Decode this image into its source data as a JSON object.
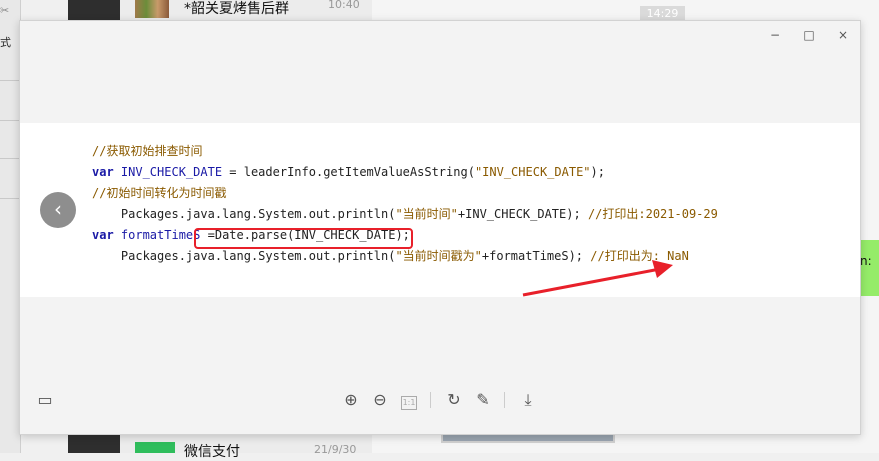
{
  "background": {
    "left_edge_labels": [
      "式"
    ],
    "chat_list_top": {
      "title": "*韶关夏烤售后群",
      "time": "10:40"
    },
    "chat_list_bottom": {
      "title": "微信支付",
      "date": "21/9/30"
    },
    "chat_time_pill": "14:29",
    "bubble_text": "n:"
  },
  "viewer": {
    "window_controls": {
      "minimize": "−",
      "maximize": "□",
      "close": "×"
    },
    "code_lines": [
      [
        {
          "t": "//获取初始排查时间",
          "c": "cmt"
        }
      ],
      [
        {
          "t": "var ",
          "c": "kw"
        },
        {
          "t": "INV_CHECK_DATE",
          "c": "var"
        },
        {
          "t": " = leaderInfo.getItemValueAsString(",
          "c": "plain"
        },
        {
          "t": "\"INV_CHECK_DATE\"",
          "c": "str"
        },
        {
          "t": ");",
          "c": "plain"
        }
      ],
      [
        {
          "t": "//初始时间转化为时间戳",
          "c": "cmt"
        }
      ],
      [
        {
          "t": "    Packages.java.lang.System.out.println(",
          "c": "plain"
        },
        {
          "t": "\"当前时间\"",
          "c": "str"
        },
        {
          "t": "+INV_CHECK_DATE); ",
          "c": "plain"
        },
        {
          "t": "//打印出:2021-09-29",
          "c": "cmt"
        }
      ],
      [
        {
          "t": "var ",
          "c": "kw"
        },
        {
          "t": "formatTimeS",
          "c": "var"
        },
        {
          "t": " =Date.parse(INV_CHECK_DATE);",
          "c": "plain"
        }
      ],
      [
        {
          "t": "    Packages.java.lang.System.out.println(",
          "c": "plain"
        },
        {
          "t": "\"当前时间戳为\"",
          "c": "str"
        },
        {
          "t": "+formatTimeS); ",
          "c": "plain"
        },
        {
          "t": "//打印出为: NaN",
          "c": "cmt"
        }
      ]
    ],
    "nav_prev": "‹",
    "toolbar": {
      "layout": "▭",
      "zoom_in": "⊕",
      "zoom_out": "⊖",
      "actual_size": "1:1",
      "rotate": "↻",
      "edit": "✎",
      "download": "⤓"
    },
    "colors": {
      "highlight": "#e8202a",
      "arrow": "#e8202a"
    }
  }
}
